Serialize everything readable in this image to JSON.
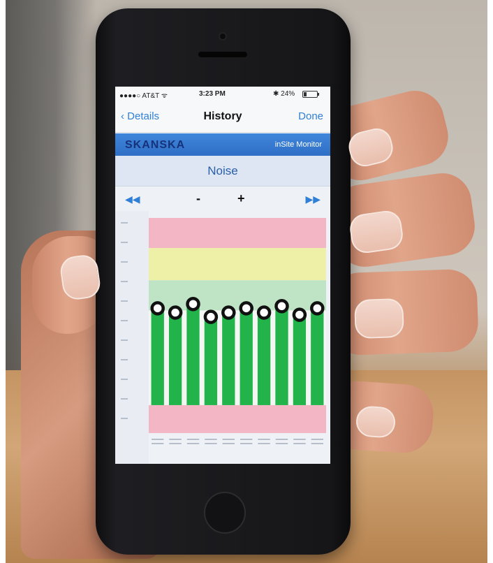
{
  "status_bar": {
    "carrier": "●●●●○ AT&T ᯤ",
    "time": "3:23 PM",
    "battery_text": "✱ 24%",
    "battery_level": 0.24
  },
  "nav": {
    "back_label": "Details",
    "title": "History",
    "done_label": "Done"
  },
  "brand": {
    "logo_text": "SKANSKA",
    "app_name": "inSite Monitor"
  },
  "section": {
    "title": "Noise"
  },
  "controls": {
    "prev_icon": "rewind-icon",
    "minus_label": "-",
    "plus_label": "+",
    "next_icon": "fast-forward-icon"
  },
  "colors": {
    "accent": "#2f7fd6",
    "brand_bar": "#2f6fc6",
    "band_red": "#f2b6c4",
    "band_yellow": "#eef0a8",
    "band_green": "#bfe3c5",
    "bar_green": "#22b44a"
  },
  "chart_data": {
    "type": "bar",
    "bands": [
      "red",
      "yellow",
      "green",
      "light",
      "red"
    ],
    "values": [
      0.58,
      0.56,
      0.6,
      0.54,
      0.56,
      0.58,
      0.56,
      0.59,
      0.55,
      0.58
    ],
    "xlabel": "",
    "ylabel": "",
    "ylim": [
      0,
      1
    ]
  }
}
